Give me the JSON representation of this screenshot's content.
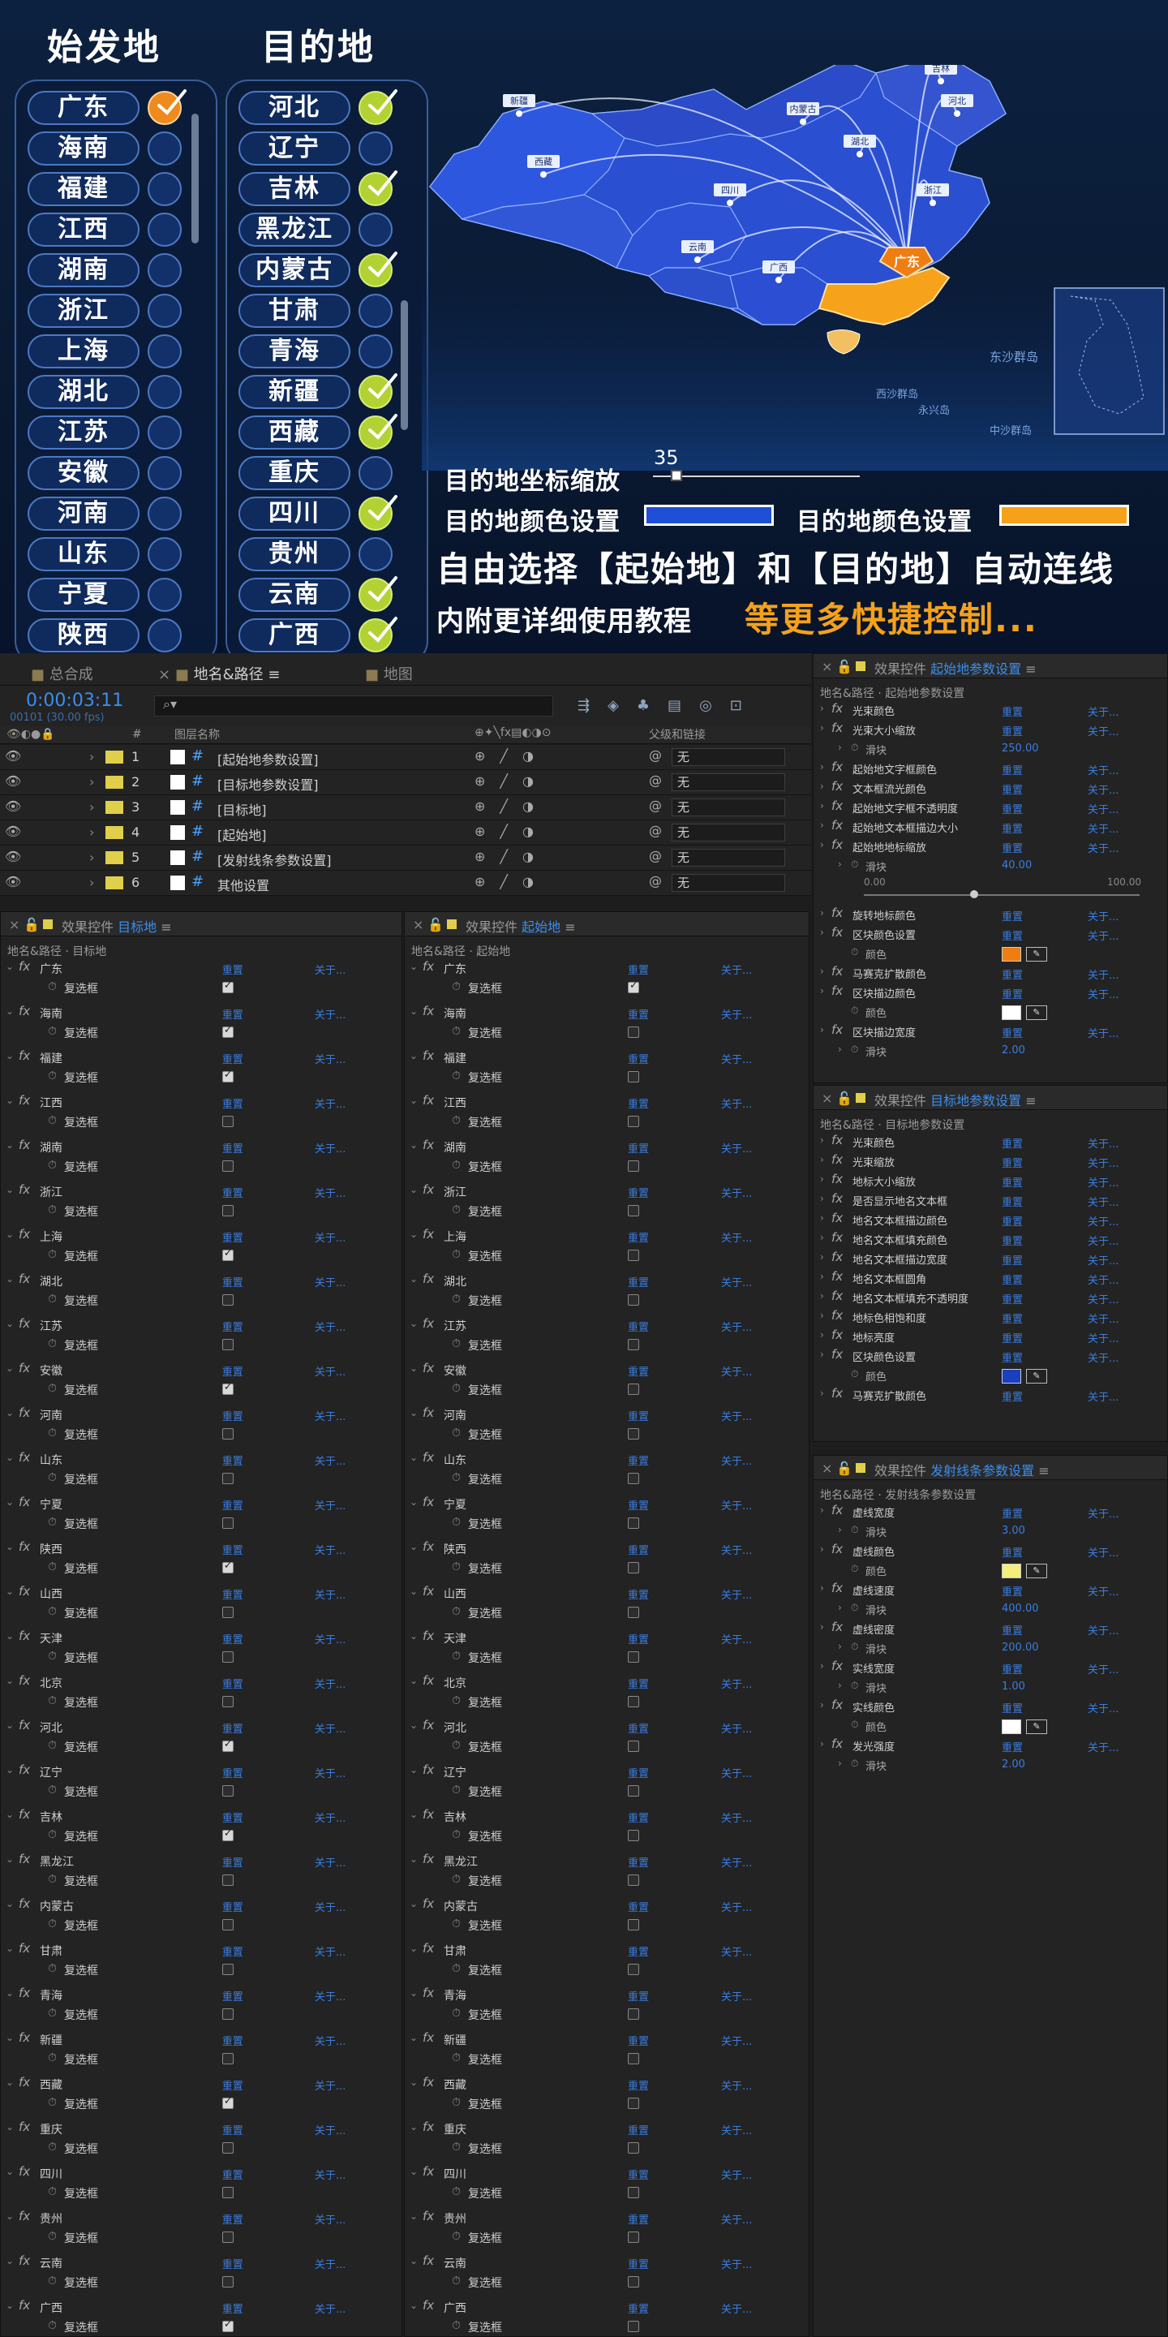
{
  "promo": {
    "origin_header": "始发地",
    "dest_header": "目的地",
    "origins": [
      {
        "name": "广东",
        "state": "selected"
      },
      {
        "name": "海南",
        "state": "off"
      },
      {
        "name": "福建",
        "state": "off"
      },
      {
        "name": "江西",
        "state": "off"
      },
      {
        "name": "湖南",
        "state": "off"
      },
      {
        "name": "浙江",
        "state": "off"
      },
      {
        "name": "上海",
        "state": "off"
      },
      {
        "name": "湖北",
        "state": "off"
      },
      {
        "name": "江苏",
        "state": "off"
      },
      {
        "name": "安徽",
        "state": "off"
      },
      {
        "name": "河南",
        "state": "off"
      },
      {
        "name": "山东",
        "state": "off"
      },
      {
        "name": "宁夏",
        "state": "off"
      },
      {
        "name": "陕西",
        "state": "off"
      }
    ],
    "destinations": [
      {
        "name": "河北",
        "state": "on"
      },
      {
        "name": "辽宁",
        "state": "off"
      },
      {
        "name": "吉林",
        "state": "on"
      },
      {
        "name": "黑龙江",
        "state": "off"
      },
      {
        "name": "内蒙古",
        "state": "on"
      },
      {
        "name": "甘肃",
        "state": "off"
      },
      {
        "name": "青海",
        "state": "off"
      },
      {
        "name": "新疆",
        "state": "on"
      },
      {
        "name": "西藏",
        "state": "on"
      },
      {
        "name": "重庆",
        "state": "off"
      },
      {
        "name": "四川",
        "state": "on"
      },
      {
        "name": "贵州",
        "state": "off"
      },
      {
        "name": "云南",
        "state": "on"
      },
      {
        "name": "广西",
        "state": "on"
      }
    ],
    "map_labels": [
      "新疆",
      "内蒙古",
      "西藏",
      "四川",
      "湖北",
      "河北",
      "吉林",
      "浙江",
      "云南",
      "广西",
      "广东"
    ],
    "sea_labels": [
      "东沙群岛",
      "西沙群岛",
      "永兴岛",
      "中沙群岛"
    ],
    "scale_label": "目的地坐标缩放",
    "scale_value": "35",
    "dest_color_label": "目的地颜色设置",
    "dest_color": "#1f4fd6",
    "dest_color_label2": "目的地颜色设置",
    "dest_color2": "#f5a11a",
    "headline_a": "自由选择【起始地】和【目的地】自动连线",
    "headline_b": "内附更详细使用教程",
    "headline_c": "等更多快捷控制...",
    "colors": {
      "selected": "#ef8a1c",
      "on": "#b2d233",
      "region": "#2a4fd0",
      "origin_region": "#f6a21b"
    }
  },
  "ae": {
    "tabs": [
      "总合成",
      "地名&路径",
      "地图"
    ],
    "timecode": "0:00:03:11",
    "fps": "00101 (30.00 fps)",
    "col_num": "#",
    "col_name": "图层名称",
    "col_parent": "父级和链接",
    "layers": [
      {
        "num": "1",
        "name": "[起始地参数设置]",
        "parent": "无"
      },
      {
        "num": "2",
        "name": "[目标地参数设置]",
        "parent": "无"
      },
      {
        "num": "3",
        "name": "[目标地]",
        "parent": "无"
      },
      {
        "num": "4",
        "name": "[起始地]",
        "parent": "无"
      },
      {
        "num": "5",
        "name": "[发射线条参数设置]",
        "parent": "无"
      },
      {
        "num": "6",
        "name": "其他设置",
        "parent": "无"
      }
    ],
    "fx_prefix": "效果控件",
    "target_panel": {
      "title_hl": "目标地",
      "sub": "地名&路径 · 目标地"
    },
    "start_panel": {
      "title_hl": "起始地",
      "sub": "地名&路径 · 起始地"
    },
    "reset": "重置",
    "about": "关于...",
    "checkbox_label": "复选框",
    "target_rows": [
      {
        "name": "广东",
        "on": true
      },
      {
        "name": "海南",
        "on": true
      },
      {
        "name": "福建",
        "on": true
      },
      {
        "name": "江西",
        "on": false
      },
      {
        "name": "湖南",
        "on": false
      },
      {
        "name": "浙江",
        "on": false
      },
      {
        "name": "上海",
        "on": true
      },
      {
        "name": "湖北",
        "on": false
      },
      {
        "name": "江苏",
        "on": false
      },
      {
        "name": "安徽",
        "on": true
      },
      {
        "name": "河南",
        "on": false
      },
      {
        "name": "山东",
        "on": false
      },
      {
        "name": "宁夏",
        "on": false
      },
      {
        "name": "陕西",
        "on": true
      },
      {
        "name": "山西",
        "on": false
      },
      {
        "name": "天津",
        "on": false
      },
      {
        "name": "北京",
        "on": false
      },
      {
        "name": "河北",
        "on": true
      },
      {
        "name": "辽宁",
        "on": false
      },
      {
        "name": "吉林",
        "on": true
      },
      {
        "name": "黑龙江",
        "on": false
      },
      {
        "name": "内蒙古",
        "on": false
      },
      {
        "name": "甘肃",
        "on": false
      },
      {
        "name": "青海",
        "on": false
      },
      {
        "name": "新疆",
        "on": false
      },
      {
        "name": "西藏",
        "on": true
      },
      {
        "name": "重庆",
        "on": false
      },
      {
        "name": "四川",
        "on": false
      },
      {
        "name": "贵州",
        "on": false
      },
      {
        "name": "云南",
        "on": false
      },
      {
        "name": "广西",
        "on": true
      }
    ],
    "start_rows": [
      {
        "name": "广东",
        "on": true
      },
      {
        "name": "海南",
        "on": false
      },
      {
        "name": "福建",
        "on": false
      },
      {
        "name": "江西",
        "on": false
      },
      {
        "name": "湖南",
        "on": false
      },
      {
        "name": "浙江",
        "on": false
      },
      {
        "name": "上海",
        "on": false
      },
      {
        "name": "湖北",
        "on": false
      },
      {
        "name": "江苏",
        "on": false
      },
      {
        "name": "安徽",
        "on": false
      },
      {
        "name": "河南",
        "on": false
      },
      {
        "name": "山东",
        "on": false
      },
      {
        "name": "宁夏",
        "on": false
      },
      {
        "name": "陕西",
        "on": false
      },
      {
        "name": "山西",
        "on": false
      },
      {
        "name": "天津",
        "on": false
      },
      {
        "name": "北京",
        "on": false
      },
      {
        "name": "河北",
        "on": false
      },
      {
        "name": "辽宁",
        "on": false
      },
      {
        "name": "吉林",
        "on": false
      },
      {
        "name": "黑龙江",
        "on": false
      },
      {
        "name": "内蒙古",
        "on": false
      },
      {
        "name": "甘肃",
        "on": false
      },
      {
        "name": "青海",
        "on": false
      },
      {
        "name": "新疆",
        "on": false
      },
      {
        "name": "西藏",
        "on": false
      },
      {
        "name": "重庆",
        "on": false
      },
      {
        "name": "四川",
        "on": false
      },
      {
        "name": "贵州",
        "on": false
      },
      {
        "name": "云南",
        "on": false
      },
      {
        "name": "广西",
        "on": false
      }
    ],
    "start_param": {
      "title_hl": "起始地参数设置",
      "sub": "地名&路径 · 起始地参数设置",
      "rows": [
        {
          "t": "fx",
          "name": "光束颜色"
        },
        {
          "t": "fx",
          "name": "光束大小缩放"
        },
        {
          "t": "val",
          "name": "滑块",
          "value": "250.00"
        },
        {
          "t": "fx",
          "name": "起始地文字框颜色"
        },
        {
          "t": "fx",
          "name": "文本框流光颜色"
        },
        {
          "t": "fx",
          "name": "起始地文字框不透明度"
        },
        {
          "t": "fx",
          "name": "起始地文本框描边大小"
        },
        {
          "t": "fx",
          "name": "起始地地标缩放"
        },
        {
          "t": "val",
          "name": "滑块",
          "value": "40.00"
        },
        {
          "t": "slider",
          "min": "0.00",
          "max": "100.00",
          "level": 0.4
        },
        {
          "t": "fx",
          "name": "旋转地标颜色"
        },
        {
          "t": "fx",
          "name": "区块颜色设置"
        },
        {
          "t": "color",
          "name": "颜色",
          "color": "#f07d12"
        },
        {
          "t": "fx",
          "name": "马赛克扩散颜色"
        },
        {
          "t": "fx",
          "name": "区块描边颜色"
        },
        {
          "t": "color",
          "name": "颜色",
          "color": "#ffffff"
        },
        {
          "t": "fx",
          "name": "区块描边宽度"
        },
        {
          "t": "val",
          "name": "滑块",
          "value": "2.00"
        }
      ]
    },
    "target_param": {
      "title_hl": "目标地参数设置",
      "sub": "地名&路径 · 目标地参数设置",
      "rows": [
        {
          "t": "fx",
          "name": "光束颜色"
        },
        {
          "t": "fx",
          "name": "光束缩放"
        },
        {
          "t": "fx",
          "name": "地标大小缩放"
        },
        {
          "t": "fx",
          "name": "是否显示地名文本框"
        },
        {
          "t": "fx",
          "name": "地名文本框描边颜色"
        },
        {
          "t": "fx",
          "name": "地名文本框填充颜色"
        },
        {
          "t": "fx",
          "name": "地名文本框描边宽度"
        },
        {
          "t": "fx",
          "name": "地名文本框圆角"
        },
        {
          "t": "fx",
          "name": "地名文本框填充不透明度"
        },
        {
          "t": "fx",
          "name": "地标色相饱和度"
        },
        {
          "t": "fx",
          "name": "地标亮度"
        },
        {
          "t": "fx",
          "name": "区块颜色设置"
        },
        {
          "t": "color",
          "name": "颜色",
          "color": "#1a3fc0"
        },
        {
          "t": "fx",
          "name": "马赛克扩散颜色"
        }
      ]
    },
    "line_param": {
      "title_hl": "发射线条参数设置",
      "sub": "地名&路径 · 发射线条参数设置",
      "rows": [
        {
          "t": "fx",
          "name": "虚线宽度"
        },
        {
          "t": "val",
          "name": "滑块",
          "value": "3.00"
        },
        {
          "t": "fx",
          "name": "虚线颜色"
        },
        {
          "t": "color",
          "name": "颜色",
          "color": "#f3ef7a"
        },
        {
          "t": "fx",
          "name": "虚线速度"
        },
        {
          "t": "val",
          "name": "滑块",
          "value": "400.00"
        },
        {
          "t": "fx",
          "name": "虚线密度"
        },
        {
          "t": "val",
          "name": "滑块",
          "value": "200.00"
        },
        {
          "t": "fx",
          "name": "实线宽度"
        },
        {
          "t": "val",
          "name": "滑块",
          "value": "1.00"
        },
        {
          "t": "fx",
          "name": "实线颜色"
        },
        {
          "t": "color",
          "name": "颜色",
          "color": "#ffffff"
        },
        {
          "t": "fx",
          "name": "发光强度"
        },
        {
          "t": "val",
          "name": "滑块",
          "value": "2.00"
        }
      ]
    }
  }
}
